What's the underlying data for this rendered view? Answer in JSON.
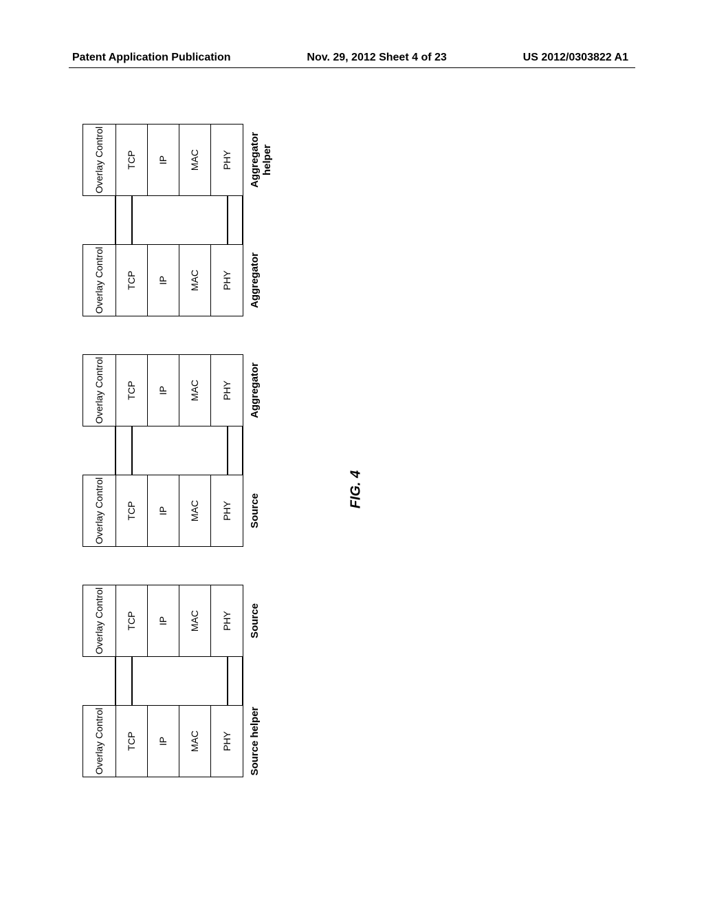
{
  "header": {
    "left": "Patent Application Publication",
    "center": "Nov. 29, 2012 Sheet 4 of 23",
    "right": "US 2012/0303822 A1"
  },
  "layers": {
    "overlay": "Overlay Control",
    "tcp": "TCP",
    "ip": "IP",
    "mac": "MAC",
    "phy": "PHY"
  },
  "stacks": [
    {
      "label": "Source helper"
    },
    {
      "label": "Source"
    },
    {
      "label": "Source"
    },
    {
      "label": "Aggregator"
    },
    {
      "label": "Aggregator"
    },
    {
      "label": "Aggregator helper"
    }
  ],
  "fig_label": "FIG. 4"
}
